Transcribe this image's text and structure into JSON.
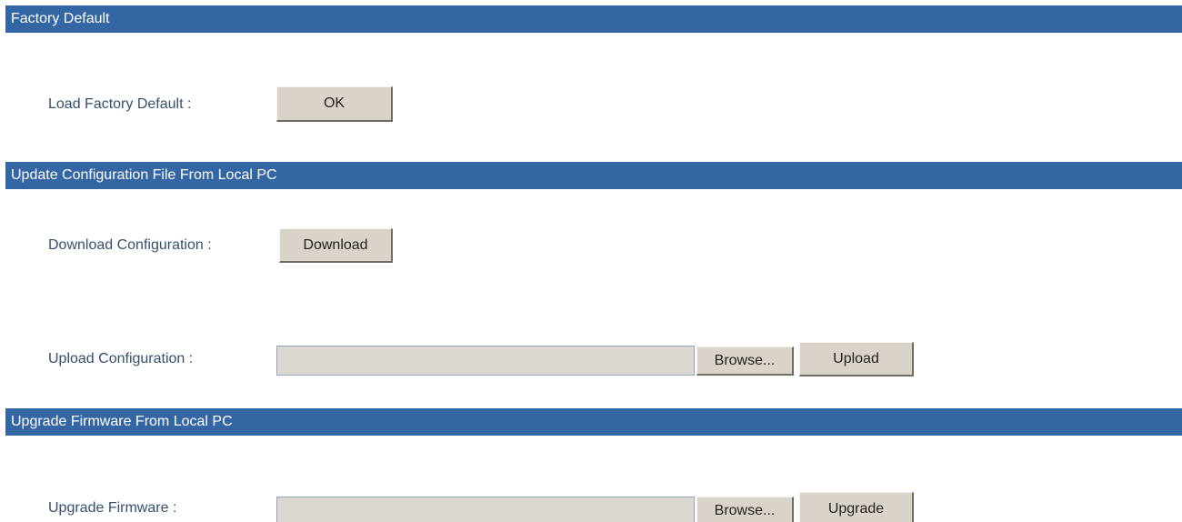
{
  "sections": {
    "factory_default": {
      "title": "Factory Default",
      "load_label": "Load Factory Default :",
      "ok_button": "OK"
    },
    "update_config": {
      "title": "Update Configuration File From Local PC",
      "download_label": "Download Configuration :",
      "download_button": "Download",
      "upload_label": "Upload Configuration :",
      "upload_file_value": "",
      "browse_button": "Browse...",
      "upload_button": "Upload"
    },
    "upgrade_firmware": {
      "title": "Upgrade Firmware From Local PC",
      "upgrade_label": "Upgrade Firmware :",
      "firmware_file_value": "",
      "browse_button": "Browse...",
      "upgrade_button": "Upgrade"
    }
  },
  "colors": {
    "section_bar": "#3366a3",
    "label_text": "#35506b",
    "button_face": "#d9d3c9"
  }
}
